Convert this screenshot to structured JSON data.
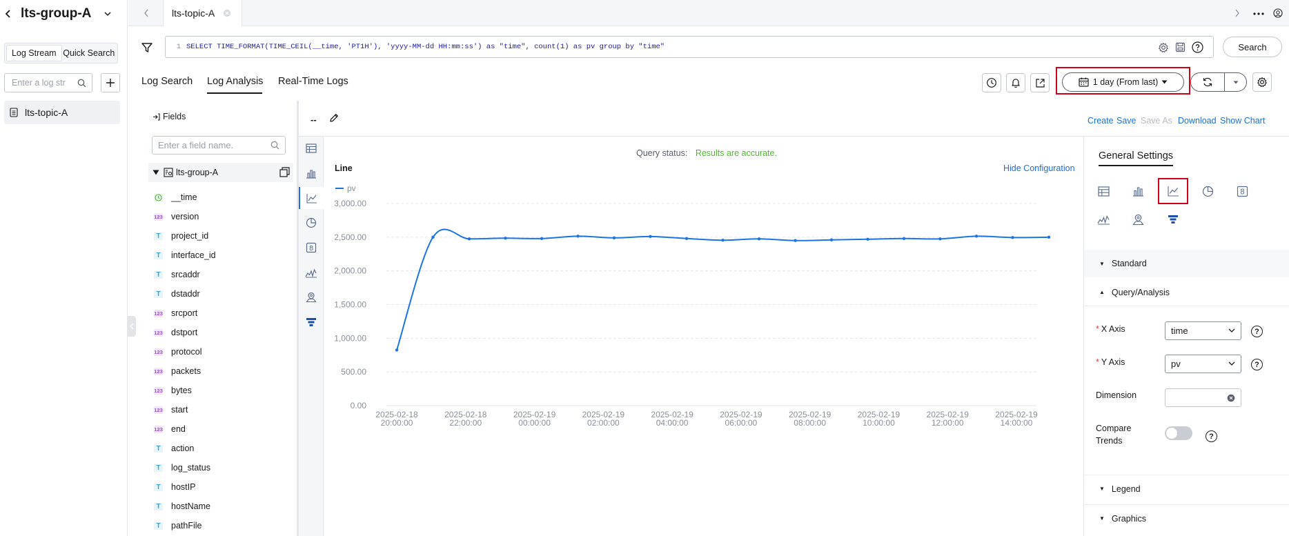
{
  "sidebar": {
    "group_title": "lts-group-A",
    "tabs": [
      "Log Stream",
      "Quick Search"
    ],
    "search_placeholder": "Enter a log str",
    "stream_items": [
      "lts-topic-A"
    ]
  },
  "tabbar": {
    "active_tab": "lts-topic-A"
  },
  "query": {
    "line_no": "1",
    "sql": "SELECT TIME_FORMAT(TIME_CEIL(__time, 'PT1H'), 'yyyy-MM-dd HH:mm:ss') as \"time\", count(1) as pv group by \"time\"",
    "search_label": "Search"
  },
  "mode_tabs": [
    "Log Search",
    "Log Analysis",
    "Real-Time Logs"
  ],
  "time_range": {
    "label": "1 day (From last)"
  },
  "fields": {
    "title": "Fields",
    "search_placeholder": "Enter a field name.",
    "group_name": "lts-group-A",
    "items": [
      {
        "name": "__time",
        "type": "time"
      },
      {
        "name": "version",
        "type": "num"
      },
      {
        "name": "project_id",
        "type": "text"
      },
      {
        "name": "interface_id",
        "type": "text"
      },
      {
        "name": "srcaddr",
        "type": "text"
      },
      {
        "name": "dstaddr",
        "type": "text"
      },
      {
        "name": "srcport",
        "type": "num"
      },
      {
        "name": "dstport",
        "type": "num"
      },
      {
        "name": "protocol",
        "type": "num"
      },
      {
        "name": "packets",
        "type": "num"
      },
      {
        "name": "bytes",
        "type": "num"
      },
      {
        "name": "start",
        "type": "num"
      },
      {
        "name": "end",
        "type": "num"
      },
      {
        "name": "action",
        "type": "text"
      },
      {
        "name": "log_status",
        "type": "text"
      },
      {
        "name": "hostIP",
        "type": "text"
      },
      {
        "name": "hostName",
        "type": "text"
      },
      {
        "name": "pathFile",
        "type": "text"
      }
    ],
    "badges": {
      "num": "123",
      "text": "T"
    }
  },
  "chart_toolbar": {
    "chart_name": "--",
    "actions": [
      "Create",
      "Save",
      "Save As",
      "Download",
      "Show Chart"
    ]
  },
  "chart_panel": {
    "status_label": "Query status:",
    "status_value": "Results are accurate.",
    "chart_kind": "Line",
    "hide_config": "Hide Configuration"
  },
  "chart_data": {
    "type": "line",
    "series": [
      {
        "name": "pv",
        "values": [
          825,
          2500,
          2475,
          2485,
          2480,
          2515,
          2490,
          2510,
          2480,
          2455,
          2475,
          2450,
          2460,
          2470,
          2480,
          2475,
          2515,
          2495,
          2500
        ]
      }
    ],
    "x_tick_labels": [
      [
        "2025-02-18",
        "20:00:00"
      ],
      [
        "2025-02-18",
        "22:00:00"
      ],
      [
        "2025-02-19",
        "00:00:00"
      ],
      [
        "2025-02-19",
        "02:00:00"
      ],
      [
        "2025-02-19",
        "04:00:00"
      ],
      [
        "2025-02-19",
        "06:00:00"
      ],
      [
        "2025-02-19",
        "08:00:00"
      ],
      [
        "2025-02-19",
        "10:00:00"
      ],
      [
        "2025-02-19",
        "12:00:00"
      ],
      [
        "2025-02-19",
        "14:00:00"
      ]
    ],
    "y_ticks": [
      0,
      500,
      1000,
      1500,
      2000,
      2500,
      3000
    ],
    "y_tick_labels": [
      "0.00",
      "500.00",
      "1,000.00",
      "1,500.00",
      "2,000.00",
      "2,500.00",
      "3,000.00"
    ],
    "ylim": [
      0,
      3000
    ],
    "grid": true,
    "legend": "top-left",
    "color": "#1b74e4"
  },
  "settings": {
    "title": "General Settings",
    "sections": {
      "standard": "Standard",
      "query": "Query/Analysis",
      "legend": "Legend",
      "graphics": "Graphics"
    },
    "x_axis": {
      "label": "X Axis",
      "value": "time"
    },
    "y_axis": {
      "label": "Y Axis",
      "value": "pv"
    },
    "dimension": {
      "label": "Dimension",
      "value": ""
    },
    "compare": {
      "label": "Compare Trends"
    }
  },
  "colors": {
    "accent": "#1b6fd6",
    "highlight": "#d0021b",
    "ok": "#4eb92e"
  }
}
